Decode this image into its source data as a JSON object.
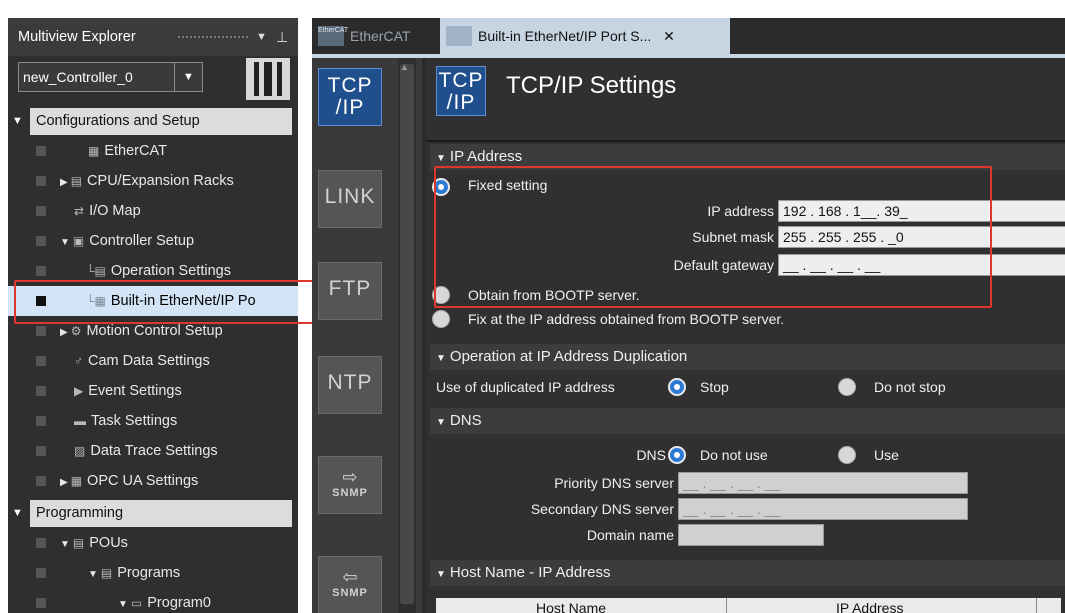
{
  "sidebar": {
    "title": "Multiview Explorer",
    "pin_icon": "pin-icon",
    "controller": "new_Controller_0",
    "items": [
      {
        "label": "EtherCAT",
        "toggle": "",
        "icon": "ethercat-icon"
      },
      {
        "label": "CPU/Expansion Racks",
        "toggle": "▶",
        "icon": "rack-icon"
      },
      {
        "label": "I/O Map",
        "toggle": "",
        "icon": "io-map-icon"
      },
      {
        "label": "Controller Setup",
        "toggle": "▼",
        "icon": "controller-setup-icon"
      },
      {
        "label": "Operation Settings",
        "toggle": "",
        "icon": "operation-settings-icon"
      },
      {
        "label": "Built-in EtherNet/IP Po",
        "toggle": "",
        "icon": "ethernet-port-icon"
      },
      {
        "label": "Motion Control Setup",
        "toggle": "▶",
        "icon": "motion-icon"
      },
      {
        "label": "Cam Data Settings",
        "toggle": "",
        "icon": "cam-icon"
      },
      {
        "label": "Event Settings",
        "toggle": "",
        "icon": "event-icon"
      },
      {
        "label": "Task Settings",
        "toggle": "",
        "icon": "task-icon"
      },
      {
        "label": "Data Trace Settings",
        "toggle": "",
        "icon": "trace-icon"
      },
      {
        "label": "OPC UA Settings",
        "toggle": "▶",
        "icon": "opcua-icon"
      }
    ],
    "sections": {
      "config": "Configurations and Setup",
      "programming": "Programming"
    },
    "prog_items": [
      {
        "label": "POUs",
        "toggle": "▼",
        "icon": "pou-icon"
      },
      {
        "label": "Programs",
        "toggle": "▼",
        "icon": "programs-icon"
      },
      {
        "label": "Program0",
        "toggle": "▼",
        "icon": "program-icon"
      }
    ]
  },
  "tabs": [
    {
      "label": "EtherCAT",
      "icon": "ethercat-tab-icon"
    },
    {
      "label": "Built-in EtherNet/IP Port S...",
      "icon": "ethernet-tab-icon",
      "close": "✕"
    }
  ],
  "nav": [
    {
      "top": "TCP",
      "bottom": "/IP",
      "name": "tcpip"
    },
    {
      "label": "LINK",
      "name": "link"
    },
    {
      "label": "FTP",
      "name": "ftp"
    },
    {
      "label": "NTP",
      "name": "ntp"
    },
    {
      "label": "SNMP",
      "name": "snmp-out"
    },
    {
      "label": "SNMP",
      "name": "snmp-in"
    }
  ],
  "content": {
    "icon_top": "TCP",
    "icon_bottom": "/IP",
    "title": "TCP/IP Settings",
    "ip_section": "IP Address",
    "fixed_setting": "Fixed setting",
    "ip_label": "IP address",
    "ip_value": "192 . 168 . 1__. 39_",
    "mask_label": "Subnet mask",
    "mask_value": "255 . 255 . 255 . _0",
    "gw_label": "Default gateway",
    "gw_value": "__ . __ . __ . __",
    "bootp": "Obtain from BOOTP server.",
    "bootp_fix": "Fix at the IP address obtained from BOOTP server.",
    "dup_section": "Operation at IP Address Duplication",
    "dup_label": "Use of duplicated IP address",
    "dup_stop": "Stop",
    "dup_nostop": "Do not stop",
    "dns_section": "DNS",
    "dns_label": "DNS",
    "dns_notuse": "Do not use",
    "dns_use": "Use",
    "pri_dns": "Priority DNS server",
    "sec_dns": "Secondary DNS server",
    "dns_empty": "__ . __ . __ . __",
    "domain": "Domain name",
    "host_section": "Host Name - IP Address",
    "host_col": "Host Name",
    "ip_col": "IP Address"
  },
  "colors": {
    "highlight": "#e0362d",
    "accent": "#1f4f8c"
  }
}
